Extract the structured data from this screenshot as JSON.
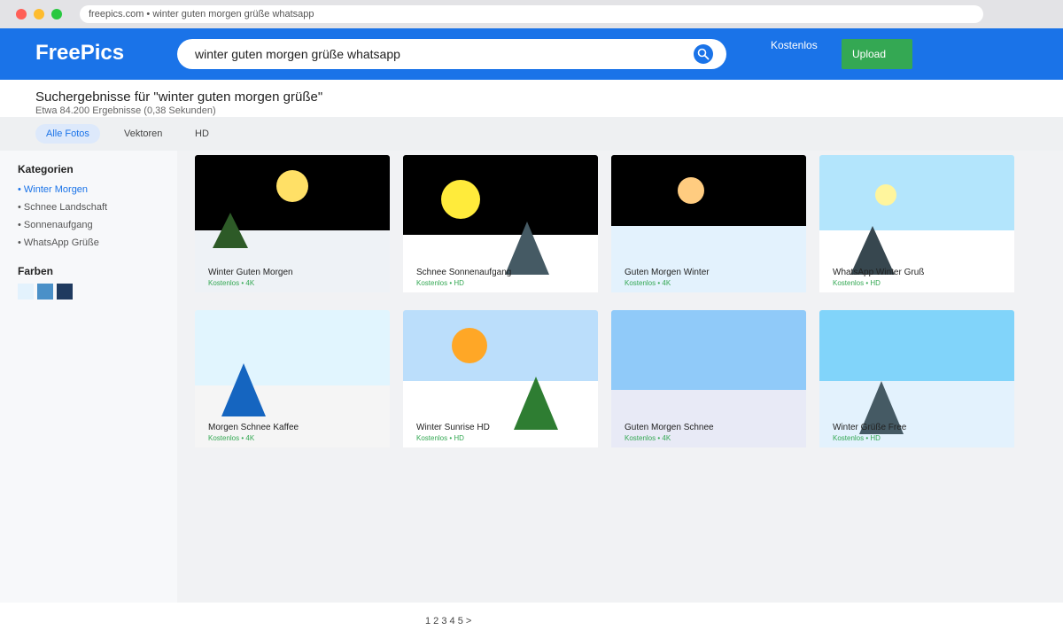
{
  "browser": {
    "url": "freepics.com • winter guten morgen grüße whatsapp"
  },
  "header": {
    "logo": "FreePics",
    "search_value": "winter guten morgen grüße whatsapp",
    "nav_link": "Kostenlos",
    "upload_label": "Upload"
  },
  "results": {
    "title": "Suchergebnisse für \"winter guten morgen grüße\"",
    "subtitle": "Etwa 84.200 Ergebnisse (0,38 Sekunden)"
  },
  "tabs": [
    {
      "label": "Alle Fotos",
      "active": true
    },
    {
      "label": "Vektoren",
      "active": false
    },
    {
      "label": "HD",
      "active": false
    }
  ],
  "sidebar": {
    "categories_heading": "Kategorien",
    "categories": [
      {
        "label": "• Winter Morgen",
        "active": true
      },
      {
        "label": "• Schnee Landschaft",
        "active": false
      },
      {
        "label": "• Sonnenaufgang",
        "active": false
      },
      {
        "label": "• WhatsApp Grüße",
        "active": false
      }
    ],
    "colors_heading": "Farben",
    "colors": [
      "#e3f2fd",
      "#4a90c8",
      "#1f3a5f"
    ]
  },
  "cards": [
    {
      "title": "Winter Guten Morgen",
      "meta": "Kostenlos • 4K",
      "sky": "#000000",
      "ground": "#eef2f6",
      "sun": "#ffe066",
      "tree": "#2d5a27"
    },
    {
      "title": "Schnee Sonnenaufgang",
      "meta": "Kostenlos • HD",
      "sky": "#000000",
      "ground": "#ffffff",
      "sun": "#ffeb3b",
      "tree": "#455a64"
    },
    {
      "title": "Guten Morgen Winter",
      "meta": "Kostenlos • 4K",
      "sky": "#000000",
      "ground": "#e3f2fd",
      "sun": "#ffcc80",
      "tree": ""
    },
    {
      "title": "WhatsApp Winter Gruß",
      "meta": "Kostenlos • HD",
      "sky": "#b3e5fc",
      "ground": "#ffffff",
      "sun": "#fff59d",
      "tree": "#37474f"
    },
    {
      "title": "Morgen Schnee Kaffee",
      "meta": "Kostenlos • 4K",
      "sky": "#e1f5fe",
      "ground": "#f5f5f5",
      "sun": "",
      "tree": "#1565c0"
    },
    {
      "title": "Winter Sunrise HD",
      "meta": "Kostenlos • HD",
      "sky": "#bbdefb",
      "ground": "#ffffff",
      "sun": "#ffa726",
      "tree": "#2e7d32"
    },
    {
      "title": "Guten Morgen Schnee",
      "meta": "Kostenlos • 4K",
      "sky": "#90caf9",
      "ground": "#e8eaf6",
      "sun": "",
      "tree": ""
    },
    {
      "title": "Winter Grüße Free",
      "meta": "Kostenlos • HD",
      "sky": "#81d4fa",
      "ground": "#e3f2fd",
      "sun": "",
      "tree": "#455a64"
    }
  ],
  "pagination": {
    "label": "1 2 3 4 5 >"
  }
}
